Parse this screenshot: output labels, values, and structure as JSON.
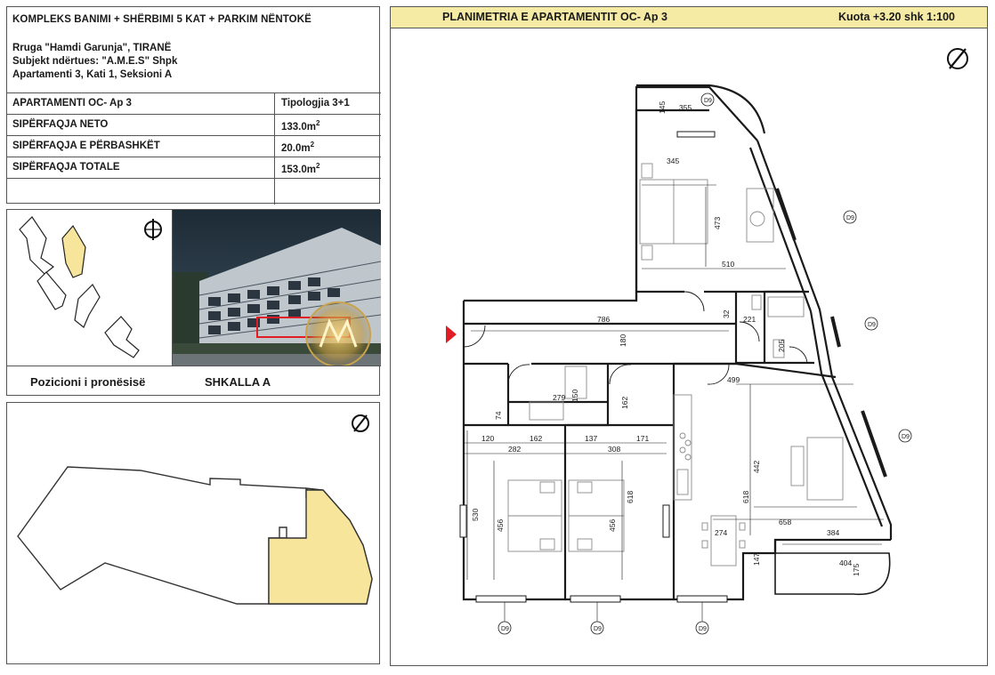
{
  "project": {
    "title": "KOMPLEKS BANIMI + SHËRBIMI 5 KAT + PARKIM NËNTOKË",
    "address": "Rruga \"Hamdi Garunja\", TIRANË",
    "developer": "Subjekt ndërtues: \"A.M.E.S\" Shpk",
    "unit": "Apartamenti 3, Kati 1, Seksioni A"
  },
  "table": {
    "apartment_label": "APARTAMENTI  OC- Ap 3",
    "typology": "Tipologjia 3+1",
    "rows": [
      {
        "label": "SIPËRFAQJA NETO",
        "value": "133.0m"
      },
      {
        "label": "SIPËRFAQJA E PËRBASHKËT",
        "value": "20.0m"
      },
      {
        "label": "SIPËRFAQJA TOTALE",
        "value": "153.0m"
      }
    ],
    "unit_sup": "2"
  },
  "position": {
    "caption": "Pozicioni i pronësisë",
    "stair": "SHKALLA  A"
  },
  "plan": {
    "title": "PLANIMETRIA E APARTAMENTIT OC- Ap 3",
    "level": "Kuota +3.20   shk 1:100",
    "dimensions": {
      "d786": "786",
      "d180": "180",
      "d345": "345",
      "d473": "473",
      "d510": "510",
      "d355": "355",
      "d145": "145",
      "d221": "221",
      "d205": "205",
      "d32": "32",
      "d279": "279",
      "d150": "150",
      "d162a": "162",
      "d499": "499",
      "d120": "120",
      "d162b": "162",
      "d137": "137",
      "d171": "171",
      "d282": "282",
      "d308": "308",
      "d530": "530",
      "d456a": "456",
      "d456b": "456",
      "d618a": "618",
      "d618b": "618",
      "d442": "442",
      "d658": "658",
      "d274": "274",
      "d384": "384",
      "d147": "147",
      "d404": "404",
      "d175": "175",
      "d74": "74"
    },
    "window_tags": [
      "D9",
      "D9",
      "D9",
      "D9",
      "D9",
      "D9",
      "D9"
    ]
  },
  "icons": {
    "north": "north-arrow-icon",
    "entry": "entry-arrow-icon",
    "watermark": "ames-watermark-logo"
  },
  "colors": {
    "highlight": "#f6e59a",
    "header": "#f6eba4",
    "entry": "#e01c24",
    "line": "#1a1a1a"
  }
}
